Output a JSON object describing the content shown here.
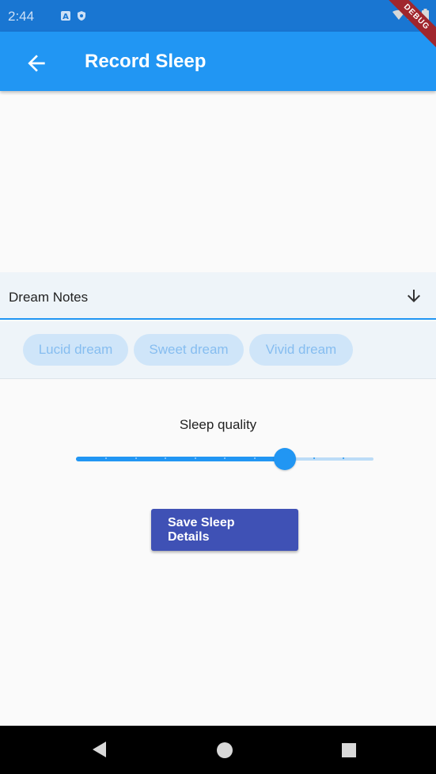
{
  "status_bar": {
    "time": "2:44",
    "icons": [
      "notification-a-icon",
      "shield-icon",
      "wifi-icon",
      "signal-icon",
      "battery-icon"
    ]
  },
  "app_bar": {
    "title": "Record Sleep",
    "back_icon": "arrow-back-icon",
    "debug_banner": "DEBUG",
    "color": "#2196f3"
  },
  "dream_notes": {
    "label": "Dream Notes",
    "icon": "arrow-downward-icon",
    "chips": [
      "Lucid dream",
      "Sweet dream",
      "Vivid dream"
    ]
  },
  "sleep_quality": {
    "label": "Sleep quality",
    "value_fraction": 0.7,
    "divisions": 10
  },
  "save_button": {
    "label": "Save Sleep Details",
    "color": "#3f51b5"
  },
  "nav_bar": {
    "icons": [
      "nav-back-icon",
      "nav-home-icon",
      "nav-recents-icon"
    ]
  }
}
